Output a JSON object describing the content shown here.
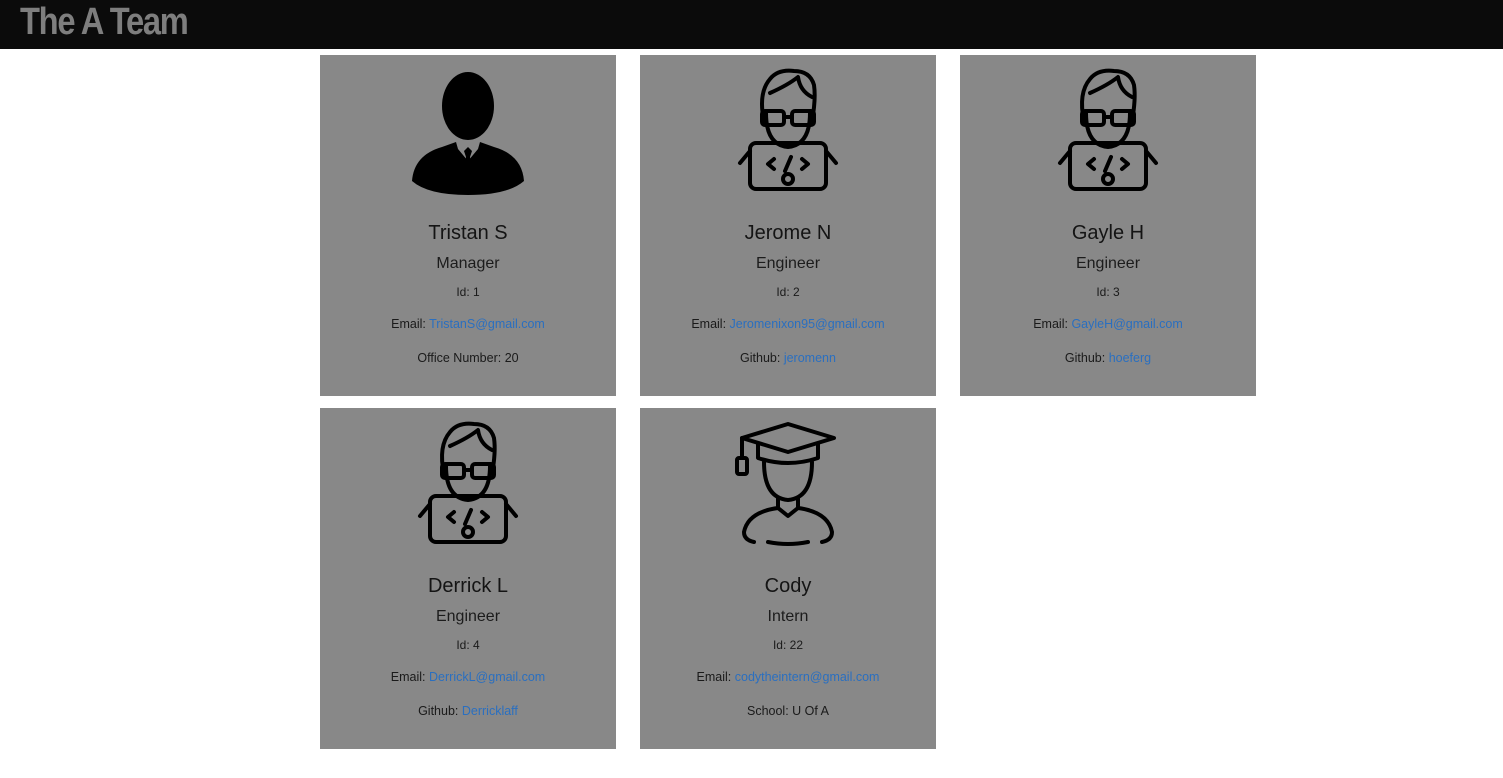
{
  "header": {
    "title": "The A Team"
  },
  "cards": [
    {
      "name": "Tristan S",
      "role": "Manager",
      "icon": "manager-icon",
      "id_label": "Id:",
      "id_value": "1",
      "email_label": "Email:",
      "email_value": "TristanS@gmail.com",
      "extra_label": "Office Number:",
      "extra_value": "20"
    },
    {
      "name": "Jerome N",
      "role": "Engineer",
      "icon": "engineer-icon",
      "id_label": "Id:",
      "id_value": "2",
      "email_label": "Email:",
      "email_value": "Jeromenixon95@gmail.com",
      "extra_label": "Github:",
      "extra_value": "jeromenn"
    },
    {
      "name": "Gayle H",
      "role": "Engineer",
      "icon": "engineer-icon",
      "id_label": "Id:",
      "id_value": "3",
      "email_label": "Email:",
      "email_value": "GayleH@gmail.com",
      "extra_label": "Github:",
      "extra_value": "hoeferg"
    },
    {
      "name": "Derrick L",
      "role": "Engineer",
      "icon": "engineer-icon",
      "id_label": "Id:",
      "id_value": "4",
      "email_label": "Email:",
      "email_value": "DerrickL@gmail.com",
      "extra_label": "Github:",
      "extra_value": "Derricklaff"
    },
    {
      "name": "Cody",
      "role": "Intern",
      "icon": "intern-icon",
      "id_label": "Id:",
      "id_value": "22",
      "email_label": "Email:",
      "email_value": "codytheintern@gmail.com",
      "extra_label": "School:",
      "extra_value": "U Of A"
    }
  ],
  "colors": {
    "header_bg": "#0b0b0b",
    "card_bg": "#888888",
    "link": "#2a6fc0"
  }
}
